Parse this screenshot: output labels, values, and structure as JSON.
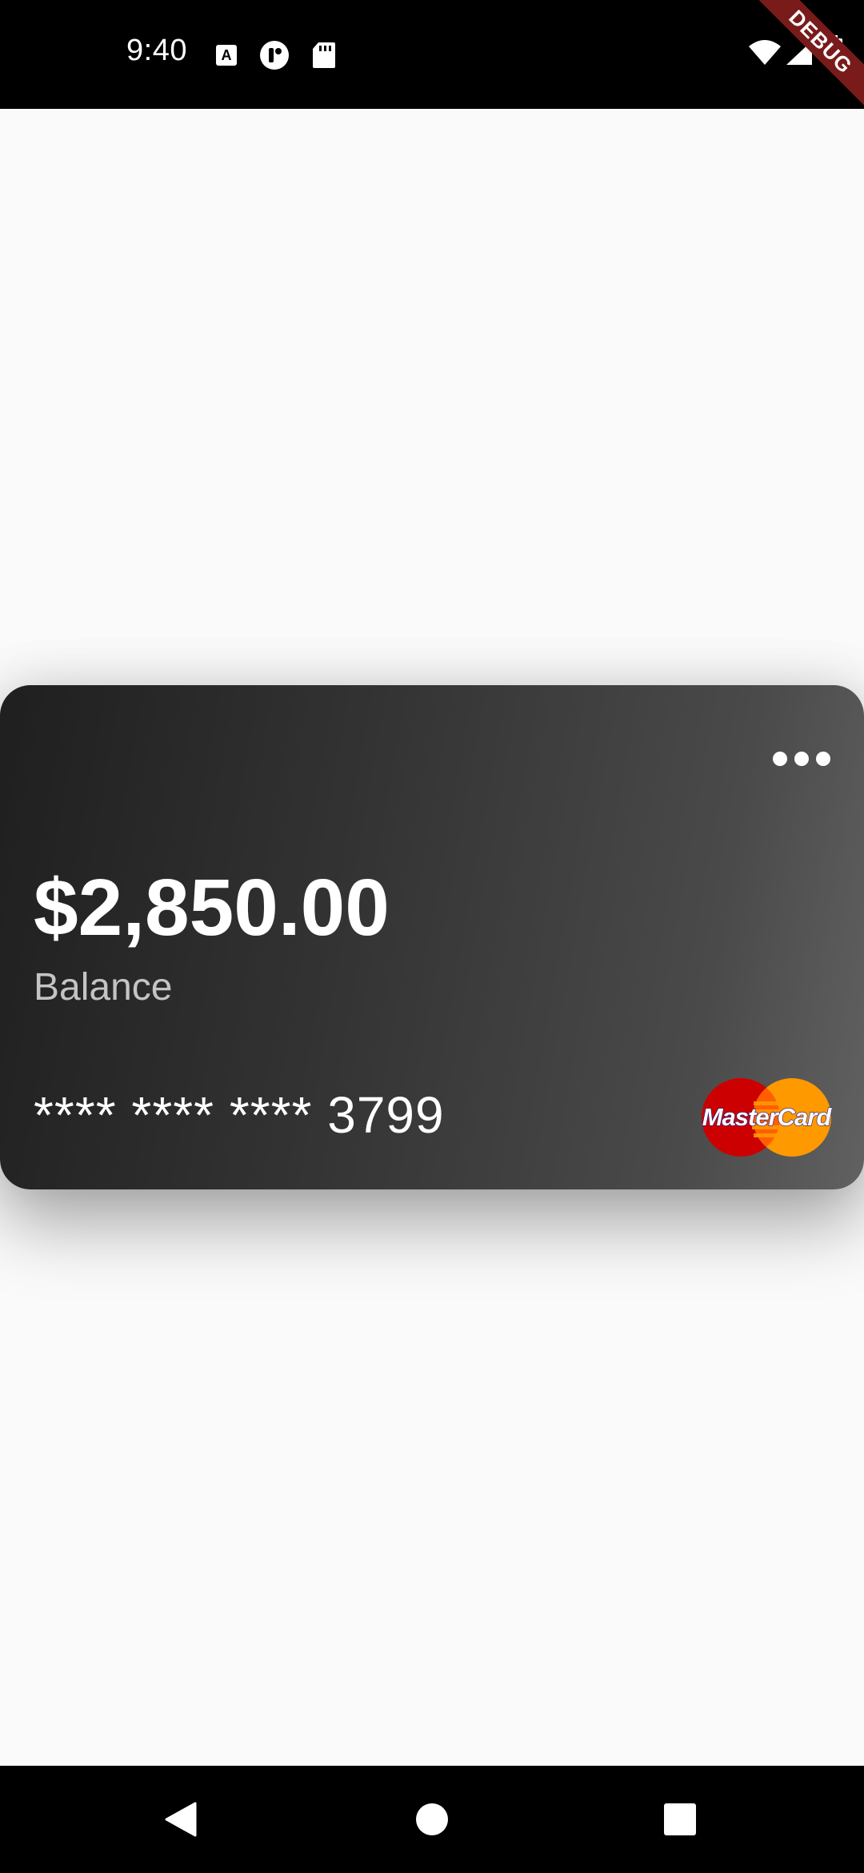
{
  "status_bar": {
    "time": "9:40",
    "icons": [
      "text-notification-icon",
      "assistant-icon",
      "sd-card-icon",
      "wifi-icon",
      "signal-icon",
      "battery-icon"
    ]
  },
  "debug_banner": {
    "label": "DEBUG",
    "color": "#7a1b1b"
  },
  "card": {
    "balance": "$2,850.00",
    "balance_label": "Balance",
    "number": "**** **** **** 3799",
    "brand": "MasterCard",
    "menu_icon": "more-horizontal-icon",
    "colors": {
      "gradient_start": "#1f1f1f",
      "gradient_end": "#616161",
      "brand_red": "#cc0000",
      "brand_orange": "#ff9900"
    }
  },
  "navigation_bar": {
    "buttons": [
      "back-icon",
      "home-icon",
      "recents-icon"
    ]
  }
}
